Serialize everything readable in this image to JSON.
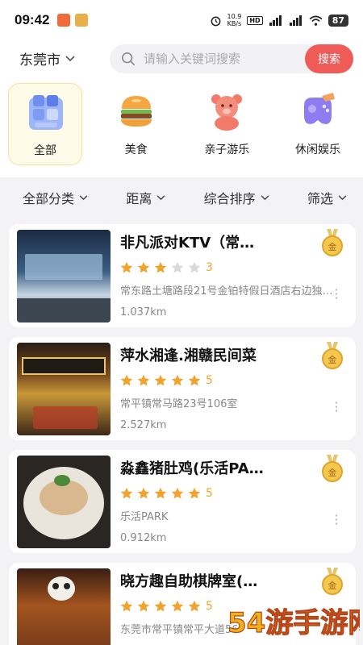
{
  "status_bar": {
    "time": "09:42",
    "net_speed": "10.9",
    "net_unit": "KB/s",
    "hd": "HD",
    "signal_1": "4G",
    "signal_2": "4G",
    "battery": "87"
  },
  "header": {
    "city": "东莞市",
    "search_placeholder": "请输入关键词搜索",
    "search_button": "搜索"
  },
  "categories": [
    {
      "label": "全部",
      "icon": "all-grid-icon",
      "active": true
    },
    {
      "label": "美食",
      "icon": "burger-icon",
      "active": false
    },
    {
      "label": "亲子游乐",
      "icon": "teddy-bear-icon",
      "active": false
    },
    {
      "label": "休闲娱乐",
      "icon": "gamepad-icon",
      "active": false
    }
  ],
  "filters": [
    {
      "label": "全部分类"
    },
    {
      "label": "距离"
    },
    {
      "label": "综合排序"
    },
    {
      "label": "筛选"
    }
  ],
  "listings": [
    {
      "name": "非凡派对KTV（常…",
      "rating": 3,
      "score": "3",
      "address": "常东路土塘路段21号金铂特假日酒店右边独…",
      "distance": "1.037km",
      "badge": "金"
    },
    {
      "name": "萍水湘逢.湘赣民间菜",
      "rating": 5,
      "score": "5",
      "address": "常平镇常马路23号106室",
      "distance": "2.527km",
      "badge": "金"
    },
    {
      "name": "淼鑫猪肚鸡(乐活PA…",
      "rating": 5,
      "score": "5",
      "address": "乐活PARK",
      "distance": "0.912km",
      "badge": "金"
    },
    {
      "name": "晓方趣自助棋牌室(…",
      "rating": 5,
      "score": "5",
      "address": "东莞市常平镇常平大道56",
      "distance": "",
      "badge": "金"
    }
  ],
  "watermark": {
    "text": "54游手游网"
  },
  "colors": {
    "accent": "#ef5b57",
    "star": "#f0a32d",
    "star_off": "#d9d9d9",
    "gold": "#e8b33c"
  }
}
